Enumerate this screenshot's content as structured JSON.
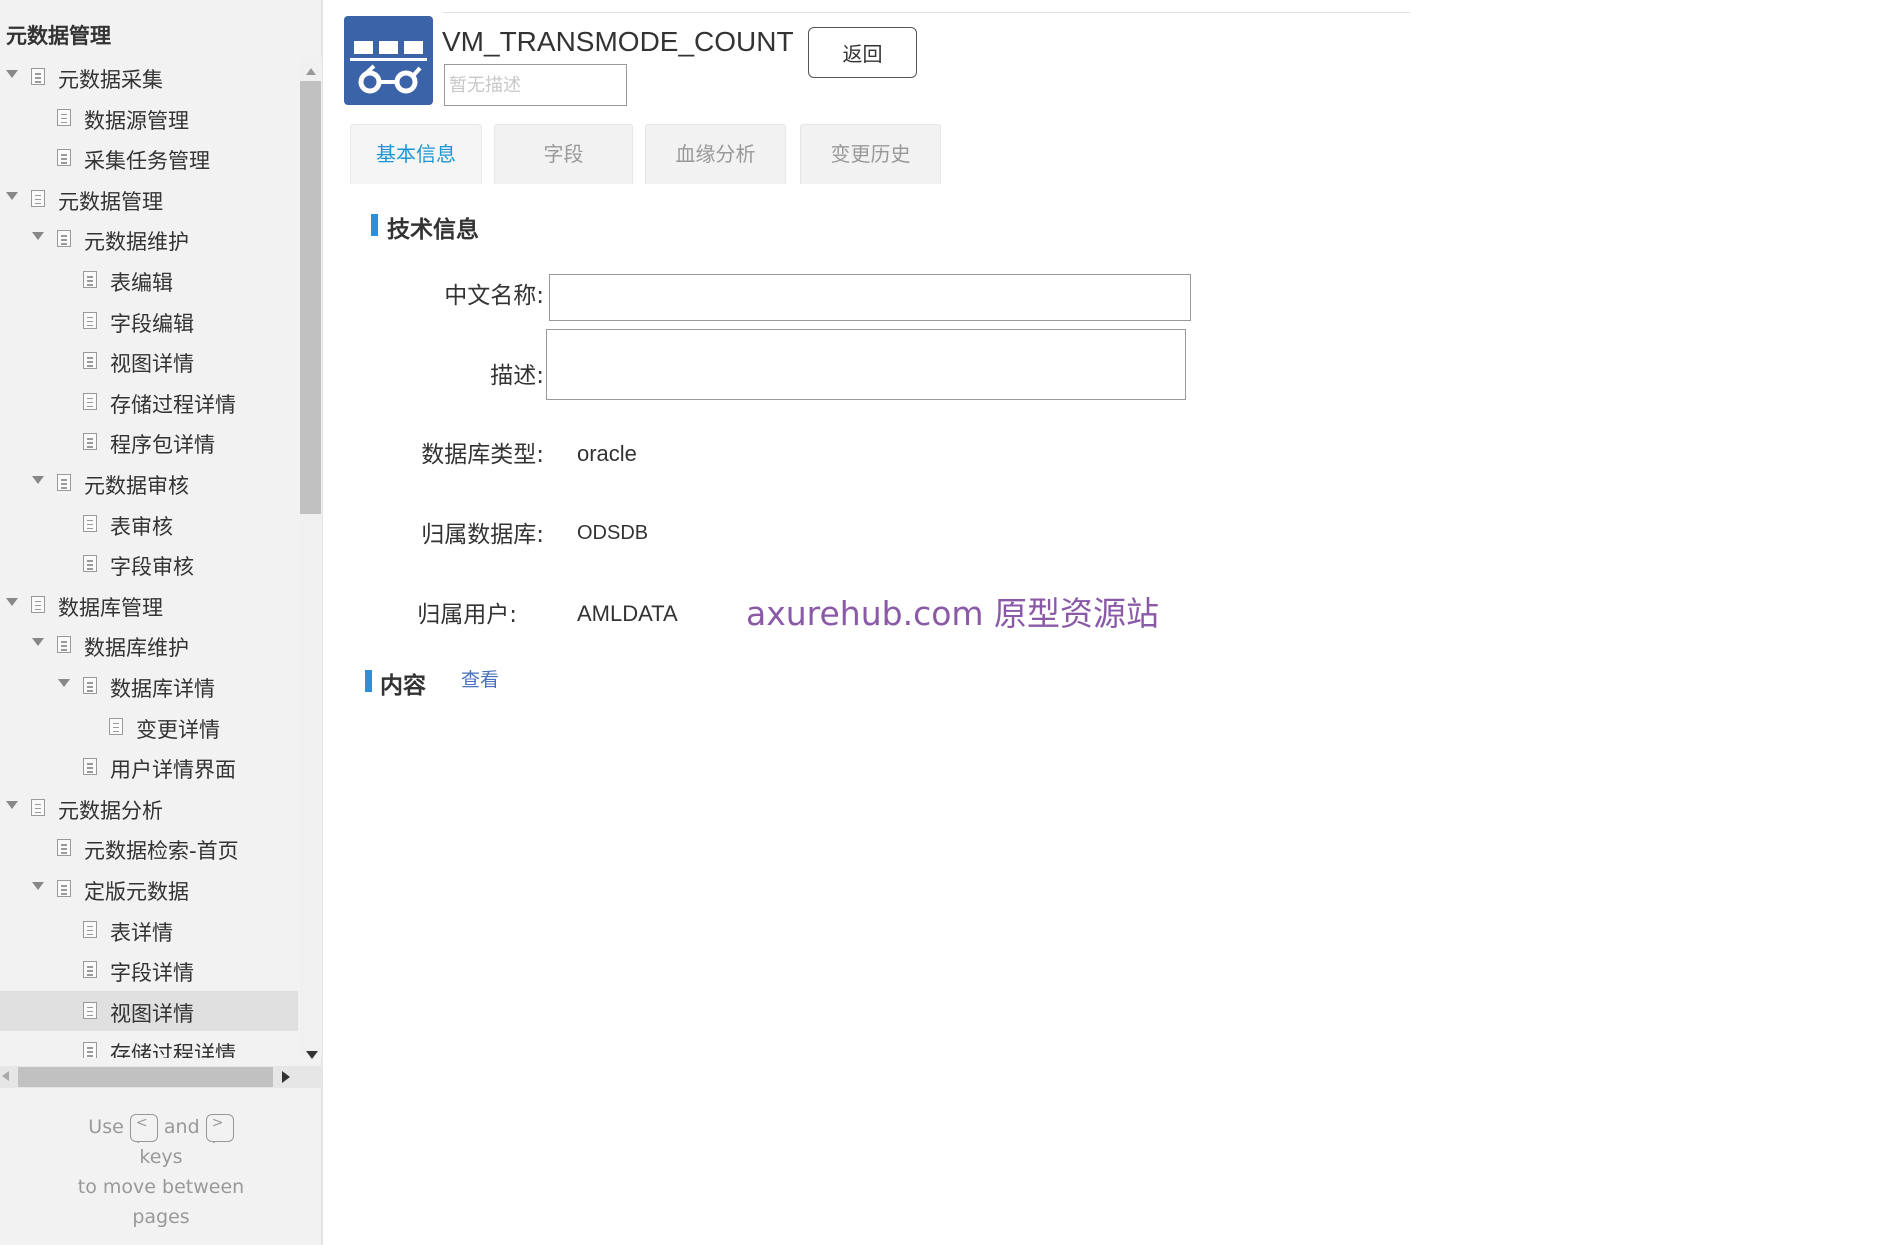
{
  "sidebar": {
    "title": "元数据管理",
    "items": [
      {
        "label": "元数据采集",
        "level": 0,
        "expanded": true
      },
      {
        "label": "数据源管理",
        "level": 1
      },
      {
        "label": "采集任务管理",
        "level": 1
      },
      {
        "label": "元数据管理",
        "level": 0,
        "expanded": true
      },
      {
        "label": "元数据维护",
        "level": 1,
        "expanded": true
      },
      {
        "label": "表编辑",
        "level": 2
      },
      {
        "label": "字段编辑",
        "level": 2
      },
      {
        "label": "视图详情",
        "level": 2
      },
      {
        "label": "存储过程详情",
        "level": 2
      },
      {
        "label": "程序包详情",
        "level": 2
      },
      {
        "label": "元数据审核",
        "level": 1,
        "expanded": true
      },
      {
        "label": "表审核",
        "level": 2
      },
      {
        "label": "字段审核",
        "level": 2
      },
      {
        "label": "数据库管理",
        "level": 0,
        "expanded": true
      },
      {
        "label": "数据库维护",
        "level": 1,
        "expanded": true
      },
      {
        "label": "数据库详情",
        "level": 2,
        "expanded": true
      },
      {
        "label": "变更详情",
        "level": 3
      },
      {
        "label": "用户详情界面",
        "level": 2
      },
      {
        "label": "元数据分析",
        "level": 0,
        "expanded": true
      },
      {
        "label": "元数据检索-首页",
        "level": 1
      },
      {
        "label": "定版元数据",
        "level": 1,
        "expanded": true
      },
      {
        "label": "表详情",
        "level": 2
      },
      {
        "label": "字段详情",
        "level": 2
      },
      {
        "label": "视图详情",
        "level": 2,
        "selected": true
      },
      {
        "label": "存储过程详情",
        "level": 2
      }
    ],
    "help": {
      "use": "Use",
      "prev_key": "<\n.",
      "and": "and",
      "next_key": ">\n.",
      "keys": "keys",
      "line2": "to move between",
      "line3": "pages"
    }
  },
  "header": {
    "table_name": "VM_TRANSMODE_COUNT",
    "desc_placeholder": "暂无描述",
    "back_label": "返回"
  },
  "tabs": [
    {
      "label": "基本信息",
      "active": true
    },
    {
      "label": "字段",
      "active": false
    },
    {
      "label": "血缘分析",
      "active": false
    },
    {
      "label": "变更历史",
      "active": false
    }
  ],
  "tech_info": {
    "section_title": "技术信息",
    "cn_name_label": "中文名称:",
    "cn_name_value": "",
    "desc_label": "描述:",
    "desc_value": "",
    "db_type_label": "数据库类型:",
    "db_type_value": "oracle",
    "db_label": "归属数据库:",
    "db_value": "ODSDB",
    "user_label": "归属用户:",
    "user_value": "AMLDATA"
  },
  "content_section": {
    "title": "内容",
    "view_link": "查看"
  },
  "watermark": "axurehub.com 原型资源站",
  "colors": {
    "accent": "#1e96d1",
    "section_bar": "#2f8ed9",
    "logo_bg": "#3a63a8",
    "link": "#4a70c0",
    "watermark": "#8a5aa8"
  }
}
